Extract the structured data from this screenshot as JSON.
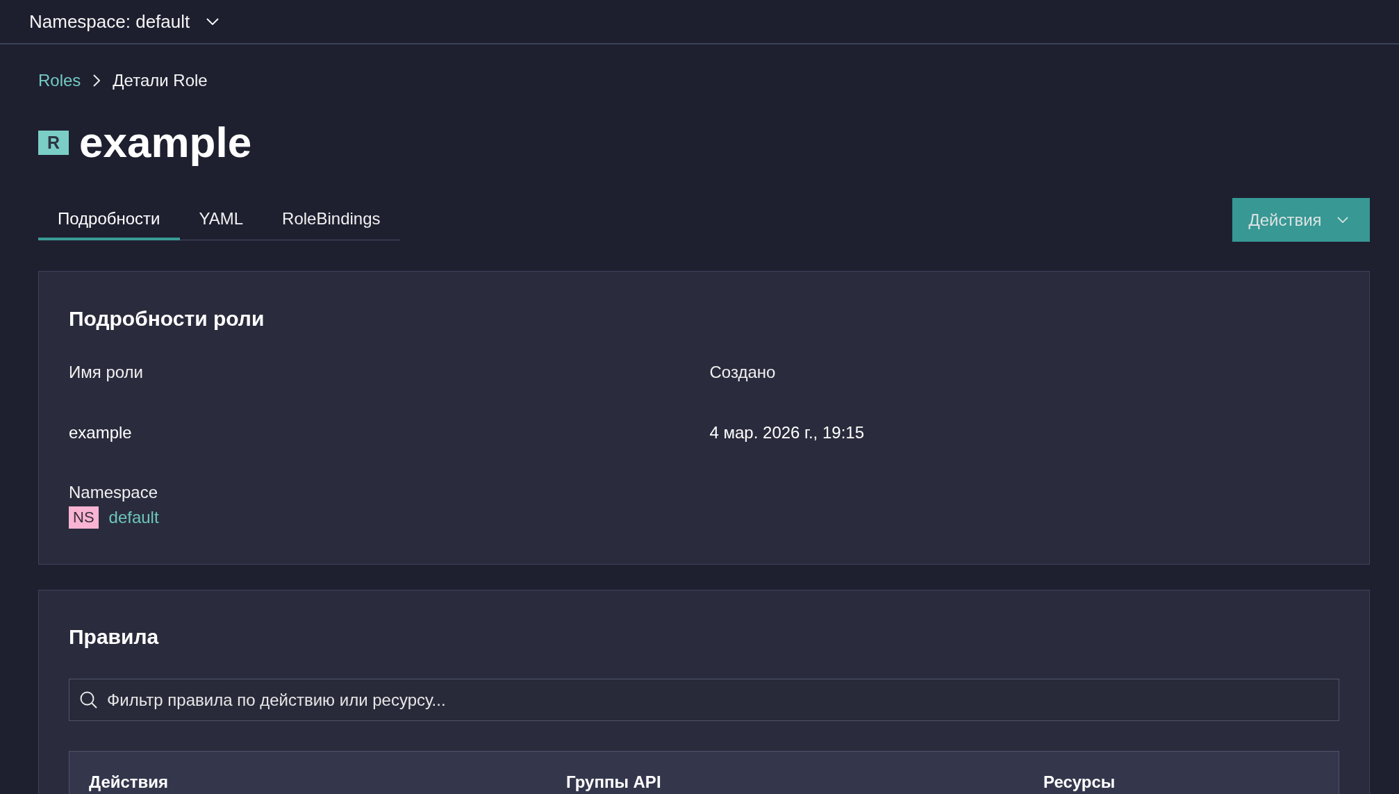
{
  "top_bar": {
    "namespace_selector": {
      "label": "Namespace: default"
    }
  },
  "breadcrumb": [
    {
      "label": "Roles",
      "kind": "link"
    },
    {
      "label": "Детали Role",
      "kind": "current"
    }
  ],
  "title": {
    "badge": "R",
    "name": "example"
  },
  "tabs": [
    {
      "label": "Подробности",
      "selected": true
    },
    {
      "label": "YAML",
      "selected": false
    },
    {
      "label": "RoleBindings",
      "selected": false
    }
  ],
  "actions_button": {
    "label": "Действия"
  },
  "details_card": {
    "title": "Подробности роли",
    "fields": [
      {
        "kind": "text",
        "label": "Имя роли",
        "value": "example"
      },
      {
        "kind": "text",
        "label": "Создано",
        "value": "4 мар. 2026 г., 19:15"
      },
      {
        "kind": "namespace",
        "label": "Namespace",
        "badge": "NS",
        "value": "default"
      }
    ]
  },
  "rules_card": {
    "title": "Правила",
    "filter": {
      "placeholder": "Фильтр правила по действию или ресурсу..."
    },
    "table": {
      "columns": [
        "Действия",
        "Группы API",
        "Ресурсы"
      ]
    }
  }
}
